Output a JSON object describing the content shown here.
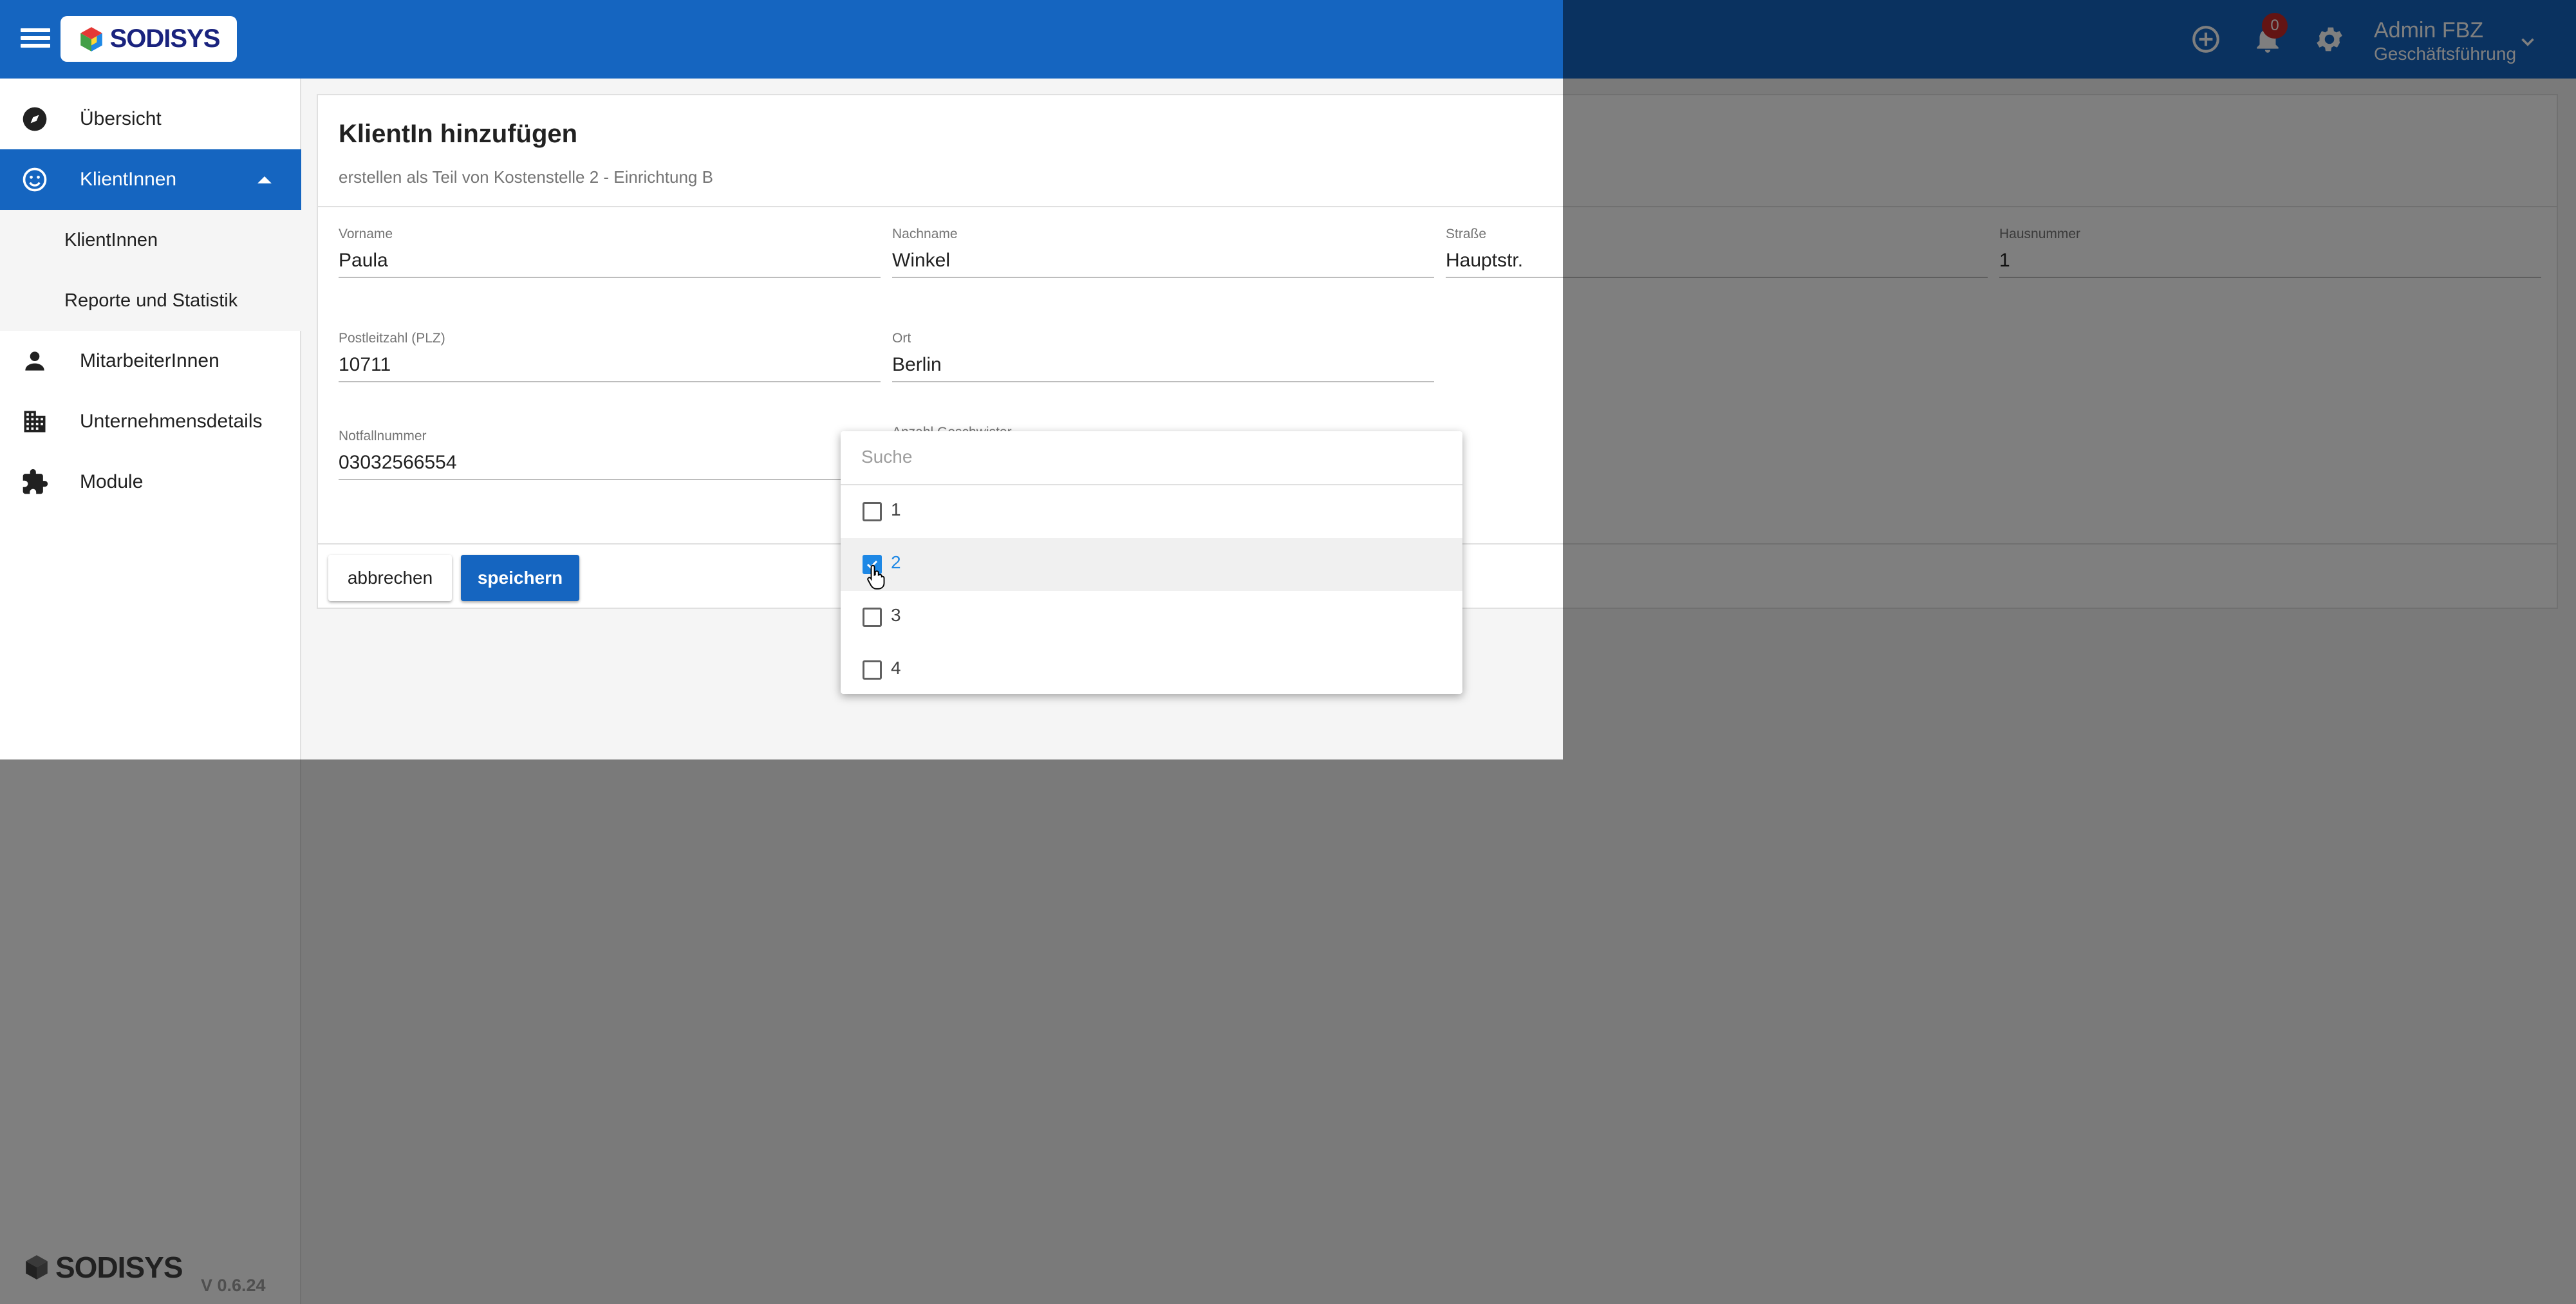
{
  "topbar": {
    "brand": "SODISYS",
    "notifications_count": "0",
    "user_name": "Admin FBZ",
    "user_role": "Geschäftsführung"
  },
  "sidebar": {
    "items": [
      {
        "label": "Übersicht",
        "icon": "compass-icon"
      },
      {
        "label": "KlientInnen",
        "icon": "smiley-icon",
        "active": true
      },
      {
        "label": "KlientInnen",
        "sub": true
      },
      {
        "label": "Reporte und Statistik",
        "sub": true
      },
      {
        "label": "MitarbeiterInnen",
        "icon": "person-icon"
      },
      {
        "label": "Unternehmensdetails",
        "icon": "building-icon"
      },
      {
        "label": "Module",
        "icon": "puzzle-icon"
      }
    ],
    "footer_brand": "SODISYS",
    "version": "V 0.6.24"
  },
  "form": {
    "title": "KlientIn hinzufügen",
    "subtitle": "erstellen als Teil von Kostenstelle 2 - Einrichtung B",
    "fields": {
      "vorname": {
        "label": "Vorname",
        "value": "Paula"
      },
      "nachname": {
        "label": "Nachname",
        "value": "Winkel"
      },
      "strasse": {
        "label": "Straße",
        "value": "Hauptstr."
      },
      "hausnummer": {
        "label": "Hausnummer",
        "value": "1"
      },
      "plz": {
        "label": "Postleitzahl (PLZ)",
        "value": "10711"
      },
      "ort": {
        "label": "Ort",
        "value": "Berlin"
      },
      "notfallnummer": {
        "label": "Notfallnummer",
        "value": "03032566554"
      },
      "geschwister": {
        "label": "Anzahl Geschwister",
        "value": "2"
      }
    },
    "cancel_label": "abbrechen",
    "save_label": "speichern"
  },
  "dropdown": {
    "search_placeholder": "Suche",
    "options": [
      {
        "label": "1",
        "checked": false
      },
      {
        "label": "2",
        "checked": true
      },
      {
        "label": "3",
        "checked": false
      },
      {
        "label": "4",
        "checked": false
      }
    ]
  },
  "colors": {
    "primary": "#1565c0",
    "check_accent": "#1e88e5",
    "badge": "#c62828"
  }
}
